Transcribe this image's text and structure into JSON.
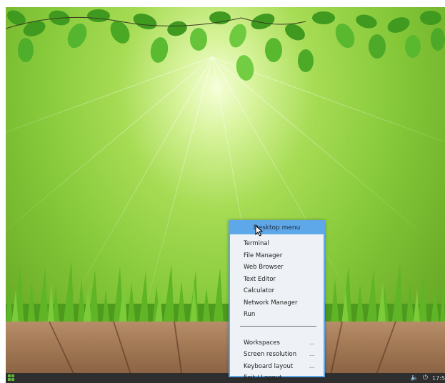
{
  "desktop_menu": {
    "title": "Desktop menu",
    "items": [
      {
        "label": "Terminal"
      },
      {
        "label": "File Manager"
      },
      {
        "label": "Web Browser"
      },
      {
        "label": "Text Editor"
      },
      {
        "label": "Calculator"
      },
      {
        "label": "Network Manager"
      },
      {
        "label": "Run"
      }
    ],
    "submenu_items": [
      {
        "label": "Workspaces",
        "more": "..."
      },
      {
        "label": "Screen resolution",
        "more": "..."
      },
      {
        "label": "Keyboard layout",
        "more": "..."
      },
      {
        "label": "Exit / Logout",
        "more": ""
      }
    ]
  },
  "taskbar": {
    "start_icon": "start-menu-icon",
    "volume_icon": "volume-icon",
    "power_icon": "power-icon",
    "clock": "17:5"
  },
  "colors": {
    "menu_accent": "#5ea8ea",
    "taskbar": "#2e2e2e",
    "wallpaper_green": "#86c93a"
  }
}
